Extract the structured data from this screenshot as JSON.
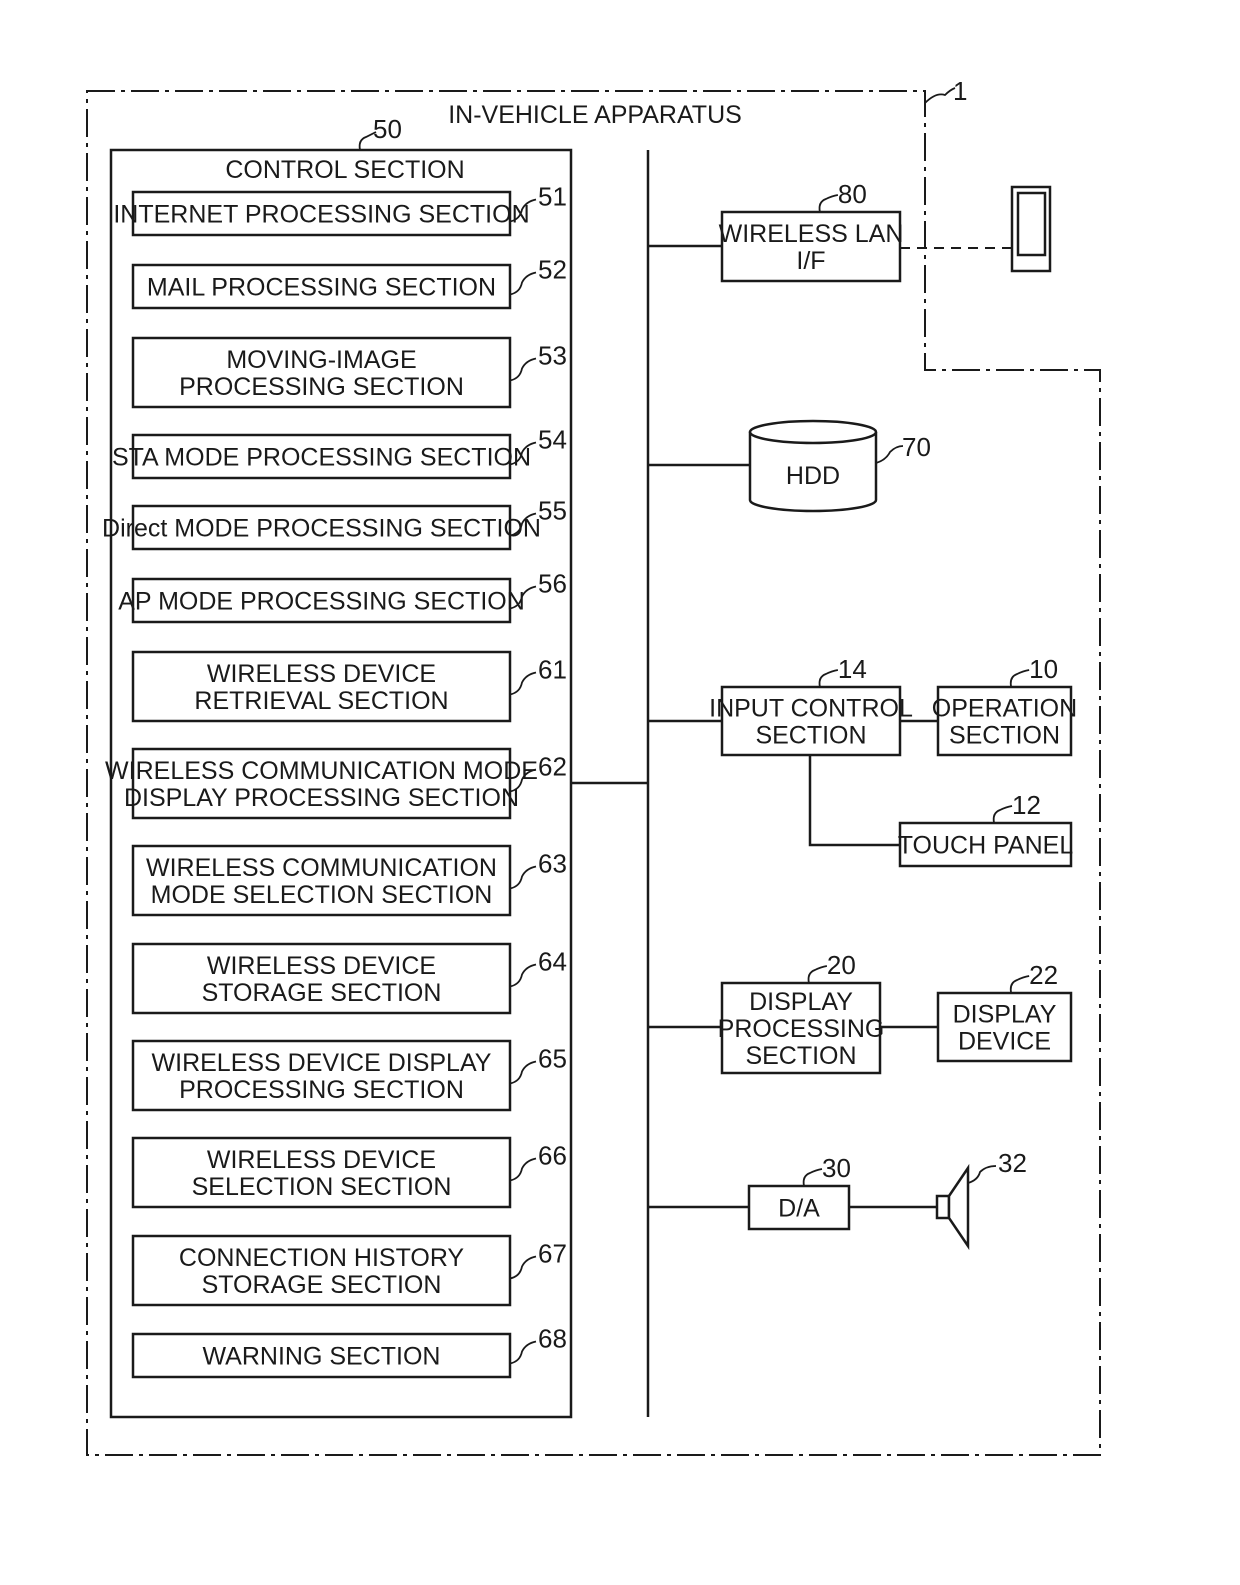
{
  "apparatus": {
    "title": "IN-VEHICLE APPARATUS",
    "ref": "1"
  },
  "control_section": {
    "title": "CONTROL SECTION",
    "ref": "50"
  },
  "control_blocks": [
    {
      "lines": [
        "INTERNET PROCESSING SECTION"
      ],
      "ref": "51"
    },
    {
      "lines": [
        "MAIL PROCESSING SECTION"
      ],
      "ref": "52"
    },
    {
      "lines": [
        "MOVING-IMAGE",
        "PROCESSING SECTION"
      ],
      "ref": "53"
    },
    {
      "lines": [
        "STA MODE PROCESSING SECTION"
      ],
      "ref": "54"
    },
    {
      "lines": [
        "Direct MODE PROCESSING SECTION"
      ],
      "ref": "55"
    },
    {
      "lines": [
        "AP MODE PROCESSING SECTION"
      ],
      "ref": "56"
    },
    {
      "lines": [
        "WIRELESS DEVICE",
        "RETRIEVAL SECTION"
      ],
      "ref": "61"
    },
    {
      "lines": [
        "WIRELESS COMMUNICATION MODE",
        "DISPLAY PROCESSING SECTION"
      ],
      "ref": "62"
    },
    {
      "lines": [
        "WIRELESS COMMUNICATION",
        "MODE SELECTION SECTION"
      ],
      "ref": "63"
    },
    {
      "lines": [
        "WIRELESS DEVICE",
        "STORAGE SECTION"
      ],
      "ref": "64"
    },
    {
      "lines": [
        "WIRELESS DEVICE DISPLAY",
        "PROCESSING SECTION"
      ],
      "ref": "65"
    },
    {
      "lines": [
        "WIRELESS DEVICE",
        "SELECTION SECTION"
      ],
      "ref": "66"
    },
    {
      "lines": [
        "CONNECTION HISTORY",
        "STORAGE SECTION"
      ],
      "ref": "67"
    },
    {
      "lines": [
        "WARNING SECTION"
      ],
      "ref": "68"
    }
  ],
  "peripherals": {
    "wireless_lan": {
      "lines": [
        "WIRELESS LAN",
        "I/F"
      ],
      "ref": "80"
    },
    "hdd": {
      "lines": [
        "HDD"
      ],
      "ref": "70"
    },
    "input_control": {
      "lines": [
        "INPUT CONTROL",
        "SECTION"
      ],
      "ref": "14"
    },
    "operation": {
      "lines": [
        "OPERATION",
        "SECTION"
      ],
      "ref": "10"
    },
    "touch_panel": {
      "lines": [
        "TOUCH PANEL"
      ],
      "ref": "12"
    },
    "display_processing": {
      "lines": [
        "DISPLAY",
        "PROCESSING",
        "SECTION"
      ],
      "ref": "20"
    },
    "display_device": {
      "lines": [
        "DISPLAY",
        "DEVICE"
      ],
      "ref": "22"
    },
    "da": {
      "lines": [
        "D/A"
      ],
      "ref": "30"
    },
    "speaker": {
      "ref": "32"
    }
  },
  "external_device": {
    "icon": "mobile-device-icon"
  }
}
